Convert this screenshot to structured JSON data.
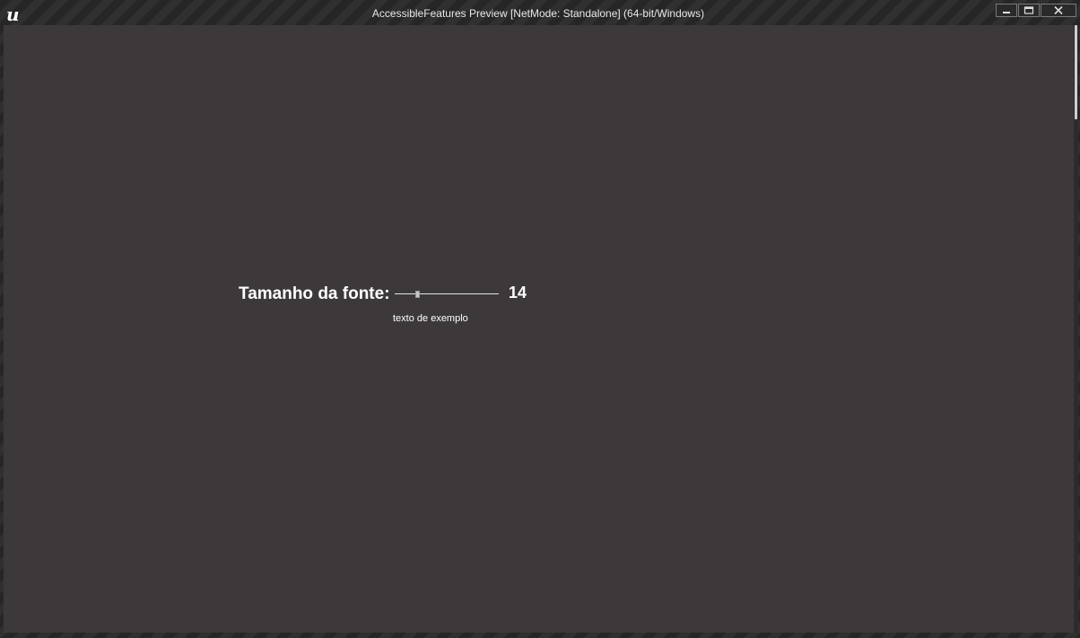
{
  "window": {
    "title": "AccessibleFeatures Preview [NetMode: Standalone]  (64-bit/Windows)",
    "logo_icon": "unreal-engine-logo-icon",
    "controls": {
      "minimize_icon": "minimize-icon",
      "maximize_icon": "maximize-icon",
      "close_icon": "close-icon"
    }
  },
  "settings": {
    "font_size_label": "Tamanho da fonte:",
    "font_size_value": "14",
    "font_size_slider_fraction": 0.21,
    "sample_text": "texto de exemplo"
  },
  "colors": {
    "viewport_background": "#3d393b",
    "text": "#ffffff"
  }
}
